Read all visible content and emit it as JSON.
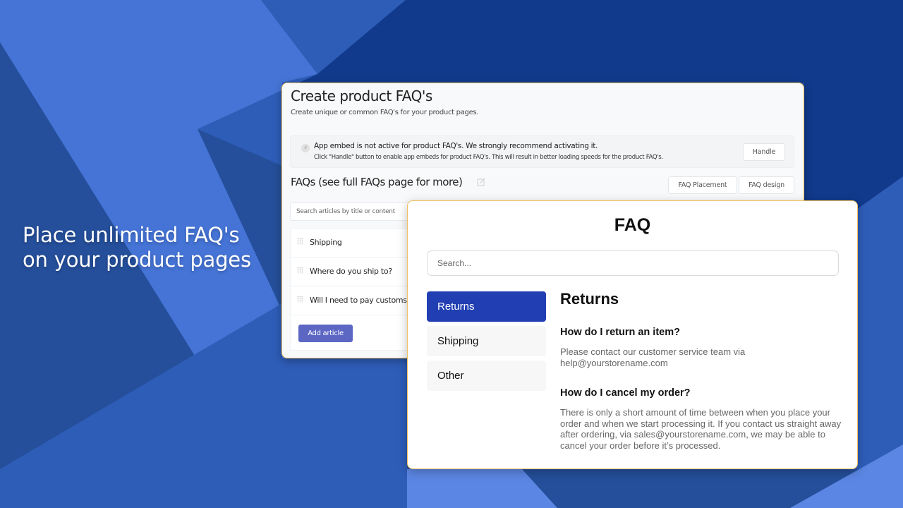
{
  "colors": {
    "bg_base": "#254f9b",
    "bg_light": "#4574d6",
    "bg_mid": "#2e5db8",
    "bg_dark": "#113a8c",
    "bg_pale": "#5b86e3",
    "card_border": "#f0c060",
    "primary_button": "#5c67c4",
    "active_category": "#213fb3"
  },
  "hero": {
    "line1": "Place unlimited FAQ's",
    "line2": "on your product pages"
  },
  "admin": {
    "title": "Create product FAQ's",
    "subtitle": "Create unique or common FAQ's for your product pages.",
    "alert": {
      "icon": "bolt-icon",
      "title": "App embed is not active for product FAQ's. We strongly recommend activating it.",
      "body": "Click \"Handle\" button to enable app embeds for product FAQ's. This will result in better loading speeds for the product FAQ's.",
      "button": "Handle"
    },
    "faqs_heading": "FAQs (see full FAQs page for more)",
    "buttons": {
      "placement": "FAQ Placement",
      "design": "FAQ design"
    },
    "search_placeholder": "Search articles by title or content",
    "articles": [
      "Shipping",
      "Where do you ship to?",
      "Will I need to pay customs duties?"
    ],
    "add_button": "Add article"
  },
  "store": {
    "title": "FAQ",
    "search_placeholder": "Search...",
    "categories": [
      {
        "label": "Returns",
        "active": true
      },
      {
        "label": "Shipping",
        "active": false
      },
      {
        "label": "Other",
        "active": false
      }
    ],
    "section_title": "Returns",
    "faqs": [
      {
        "question": "How do I return an item?",
        "answer": "Please contact our customer service team via help@yourstorename.com"
      },
      {
        "question": "How do I cancel my order?",
        "answer": "There is only a short amount of time between when you place your order and when we start processing it. If you contact us straight away after ordering, via sales@yourstorename.com, we may be able to cancel your order before it’s processed."
      }
    ]
  }
}
